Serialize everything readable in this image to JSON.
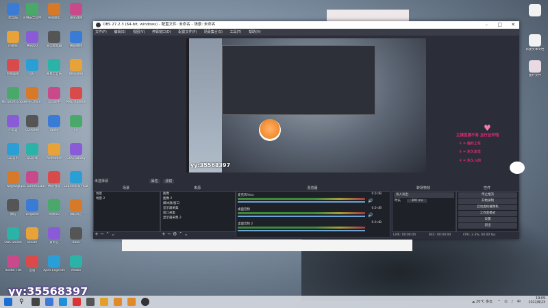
{
  "desktop": {
    "icons_col1": [
      "此电脑",
      "回收站",
      "控制面板",
      "Microsoft Edge",
      "小黑盒",
      "QQ音乐",
      "哔哩哔哩",
      "微信",
      "OBS Studio",
      "Hunter Hat"
    ],
    "icons_col2": [
      "火绒安全软件",
      "腾讯QQ",
      "QQ",
      "WPS Office",
      "CCleaner",
      "QQ游戏",
      "Epic Games Launcher",
      "wegame",
      "Steam",
      "迅雷"
    ],
    "icons_col3": [
      "英雄联盟",
      "雷电模拟器",
      "网易云音乐",
      "电竞助手",
      "Uplay",
      "Alienware",
      "腾讯会议",
      "网易UU",
      "爱奇艺",
      "Apex Legends"
    ],
    "icons_col4": [
      "暴雪战网",
      "腾讯视频",
      "WeGame",
      "AMD Radeon",
      "EA",
      "GOG Galaxy",
      "Logitech G HUB",
      "微软商店",
      "Xbox",
      "Adobe"
    ],
    "right_icons": [
      "新建文件",
      "新建文本文档",
      "图片文件"
    ]
  },
  "obs": {
    "title": "OBS 27.2.3 (64-bit, windows) - 配置文件: 未命名 - 场景: 未命名",
    "menu": [
      "文件(F)",
      "编辑(E)",
      "视图(V)",
      "停靠窗口(D)",
      "配置文件(P)",
      "场景集合(S)",
      "工具(T)",
      "帮助(H)"
    ],
    "preview_yy": "yy:35568397",
    "context": {
      "no_source": "未选择源",
      "properties": "属性",
      "filters": "滤镜"
    },
    "scenes": {
      "header": "场景",
      "items": [
        "场景",
        "场景 2"
      ]
    },
    "sources": {
      "header": "来源",
      "items": [
        "图像",
        "图像 2",
        "媒体源/窗口",
        "显示器采集",
        "窗口采集",
        "显示器采集 2"
      ]
    },
    "mixer": {
      "header": "混音器",
      "channels": [
        {
          "name": "麦克风/Aux",
          "level": "0.0 dB"
        },
        {
          "name": "桌面音频",
          "level": "0.0 dB"
        },
        {
          "name": "桌面音频 2",
          "level": "0.0 dB"
        }
      ]
    },
    "transitions": {
      "header": "转场特效",
      "type": "淡入淡出",
      "duration_label": "时长",
      "duration_value": "300 ms"
    },
    "controls": {
      "header": "控件",
      "buttons": [
        "停止推流",
        "开始录制",
        "启动虚拟摄像机",
        "工作室模式",
        "设置",
        "退出"
      ]
    },
    "status": {
      "live": "LIVE: 00:00:00",
      "rec": "REC: 00:00:00",
      "cpu": "CPU: 2.3%, 60.00 fps"
    }
  },
  "overlay": {
    "title": "主播直播不易 且行且珍惜",
    "lines": [
      "① = 临时上车",
      "② = 永久车位",
      "③ = 永久入四"
    ]
  },
  "watermark": "yy:35568397",
  "taskbar": {
    "weather": "20°C 多云",
    "time": "19:09",
    "date": "2022/8/23"
  },
  "colors": {
    "obs_bg": "#2b2e38",
    "dock_bg": "#1f2129",
    "accent": "#6da3d8",
    "overlay_text": "#e8267a"
  }
}
